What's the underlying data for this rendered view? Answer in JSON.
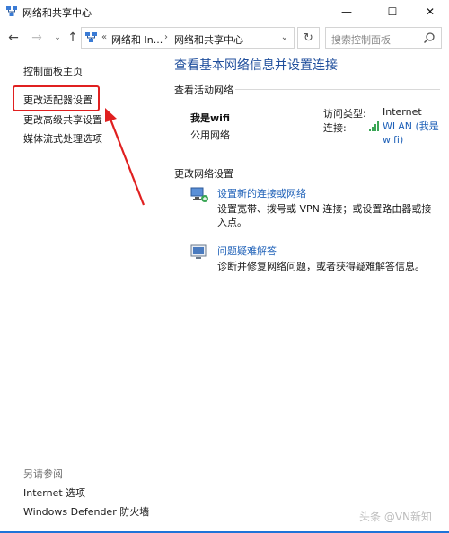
{
  "window": {
    "title": "网络和共享中心",
    "minimize": "—",
    "maximize": "☐",
    "close": "✕"
  },
  "nav": {
    "back": "←",
    "forward": "→",
    "recent": "⌄",
    "up": "↑",
    "address_segments": [
      "网络和 In...",
      "网络和共享中心"
    ],
    "address_separator": "«",
    "chevron": "›",
    "address_dropdown": "⌄",
    "refresh": "↻",
    "search_placeholder": "搜索控制面板"
  },
  "sidebar": {
    "items": [
      {
        "label": "控制面板主页"
      },
      {
        "label": "更改适配器设置"
      },
      {
        "label": "更改高级共享设置"
      },
      {
        "label": "媒体流式处理选项"
      }
    ],
    "see_also_label": "另请参阅",
    "see_also": [
      {
        "label": "Internet 选项"
      },
      {
        "label": "Windows Defender 防火墙"
      }
    ]
  },
  "main": {
    "title": "查看基本网络信息并设置连接",
    "active_networks_header": "查看活动网络",
    "network": {
      "name": "我是wifi",
      "type": "公用网络",
      "access_type_label": "访问类型:",
      "access_type_value": "Internet",
      "connection_label": "连接:",
      "connection_value": "WLAN (我是wifi)"
    },
    "change_settings_header": "更改网络设置",
    "tasks": [
      {
        "icon": "network-setup-icon",
        "link": "设置新的连接或网络",
        "desc": "设置宽带、拨号或 VPN 连接；或设置路由器或接入点。"
      },
      {
        "icon": "troubleshoot-icon",
        "link": "问题疑难解答",
        "desc": "诊断并修复网络问题，或者获得疑难解答信息。"
      }
    ]
  },
  "watermark": "头条 @VN新知",
  "colors": {
    "link": "#1f61b8",
    "title": "#1f4e9c",
    "highlight": "#e02020",
    "accent": "#1e73d8"
  }
}
